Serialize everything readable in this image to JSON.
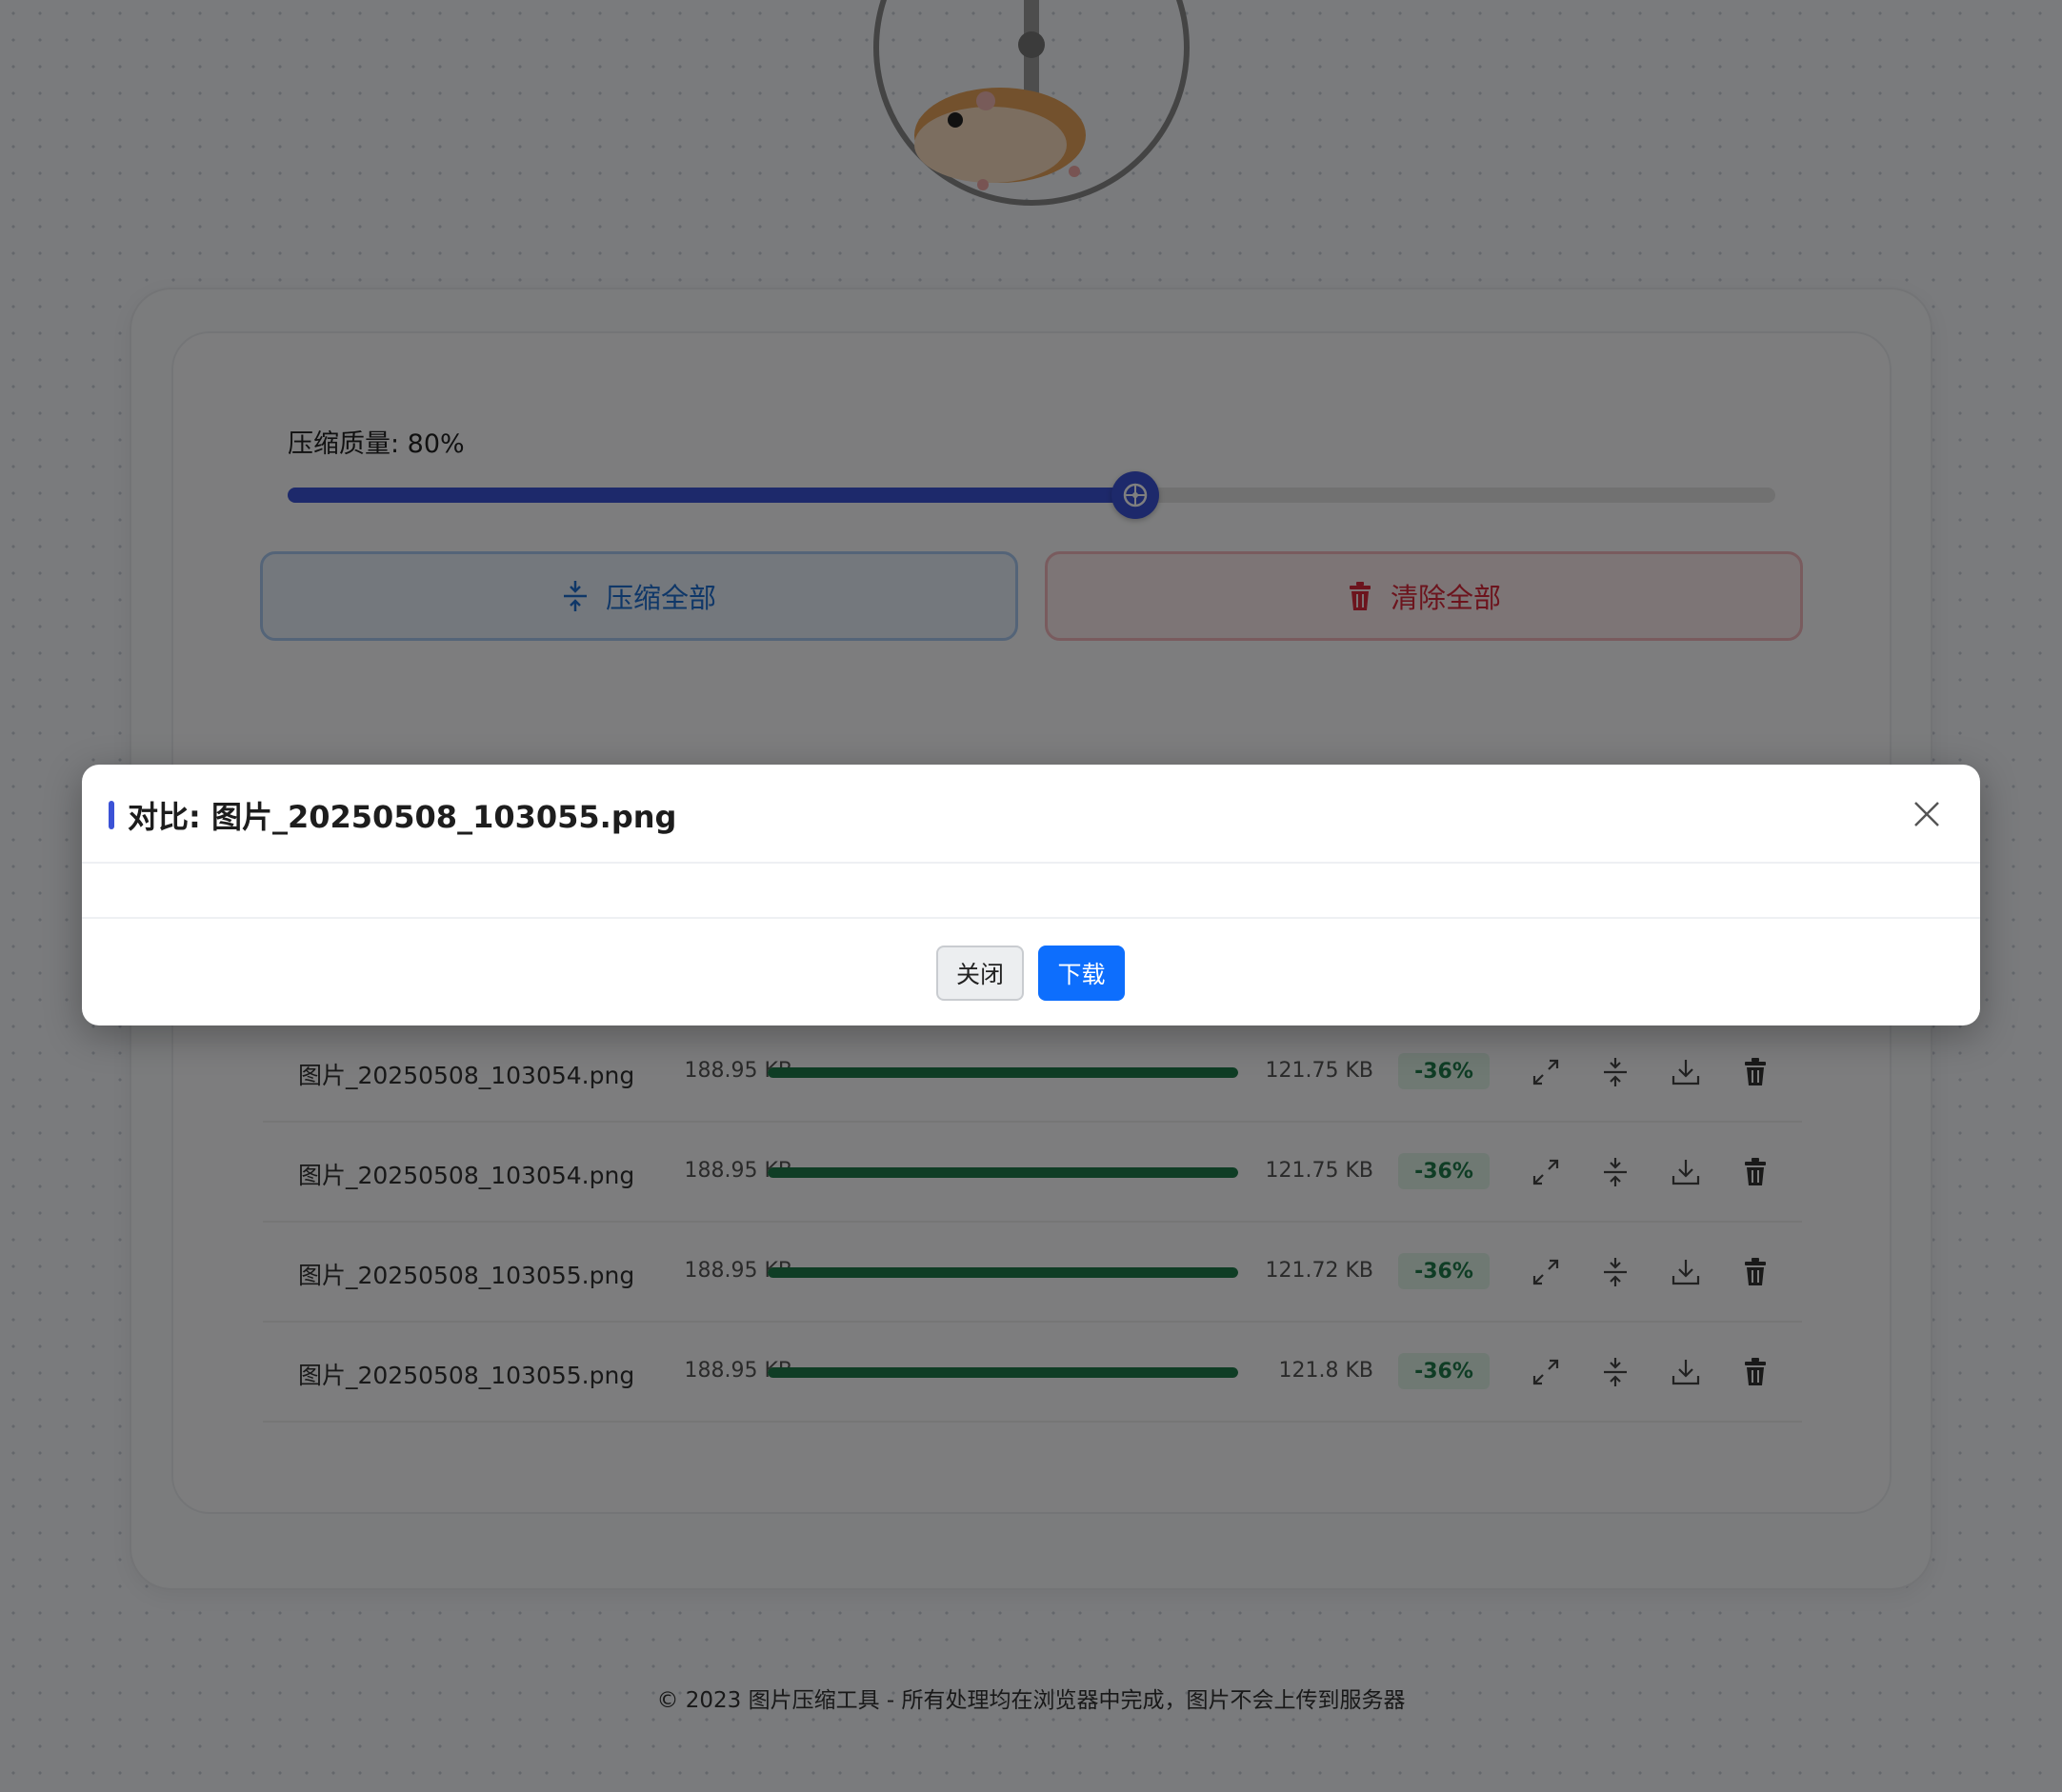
{
  "header": {
    "logo_icon": "hamster-wheel-icon"
  },
  "controls": {
    "quality_label": "压缩质量: 80%",
    "quality_value": 80,
    "compress_all_label": "压缩全部",
    "clear_all_label": "清除全部",
    "compress_icon": "compress-icon",
    "clear_icon": "trash-icon"
  },
  "files": [
    {
      "name": "图片_20250508_103054.png",
      "original_size": "188.95 KB",
      "compressed_size": "121.75 KB",
      "reduction": "-36%",
      "progress": 1.0
    },
    {
      "name": "图片_20250508_103054.png",
      "original_size": "188.95 KB",
      "compressed_size": "121.75 KB",
      "reduction": "-36%",
      "progress": 1.0
    },
    {
      "name": "图片_20250508_103055.png",
      "original_size": "188.95 KB",
      "compressed_size": "121.72 KB",
      "reduction": "-36%",
      "progress": 1.0
    },
    {
      "name": "图片_20250508_103055.png",
      "original_size": "188.95 KB",
      "compressed_size": "121.8 KB",
      "reduction": "-36%",
      "progress": 1.0
    }
  ],
  "row_actions": [
    "expand-icon",
    "compress-icon",
    "download-icon",
    "trash-icon"
  ],
  "footer": {
    "text": "© 2023 图片压缩工具 - 所有处理均在浏览器中完成，图片不会上传到服务器"
  },
  "modal": {
    "title": "对比: 图片_20250508_103055.png",
    "close_label": "关闭",
    "download_label": "下载",
    "close_icon": "close-icon"
  },
  "colors": {
    "accent": "#3b52d6",
    "success": "#1f7a4a",
    "danger": "#d9283b",
    "primary_button": "#0d6efd"
  }
}
